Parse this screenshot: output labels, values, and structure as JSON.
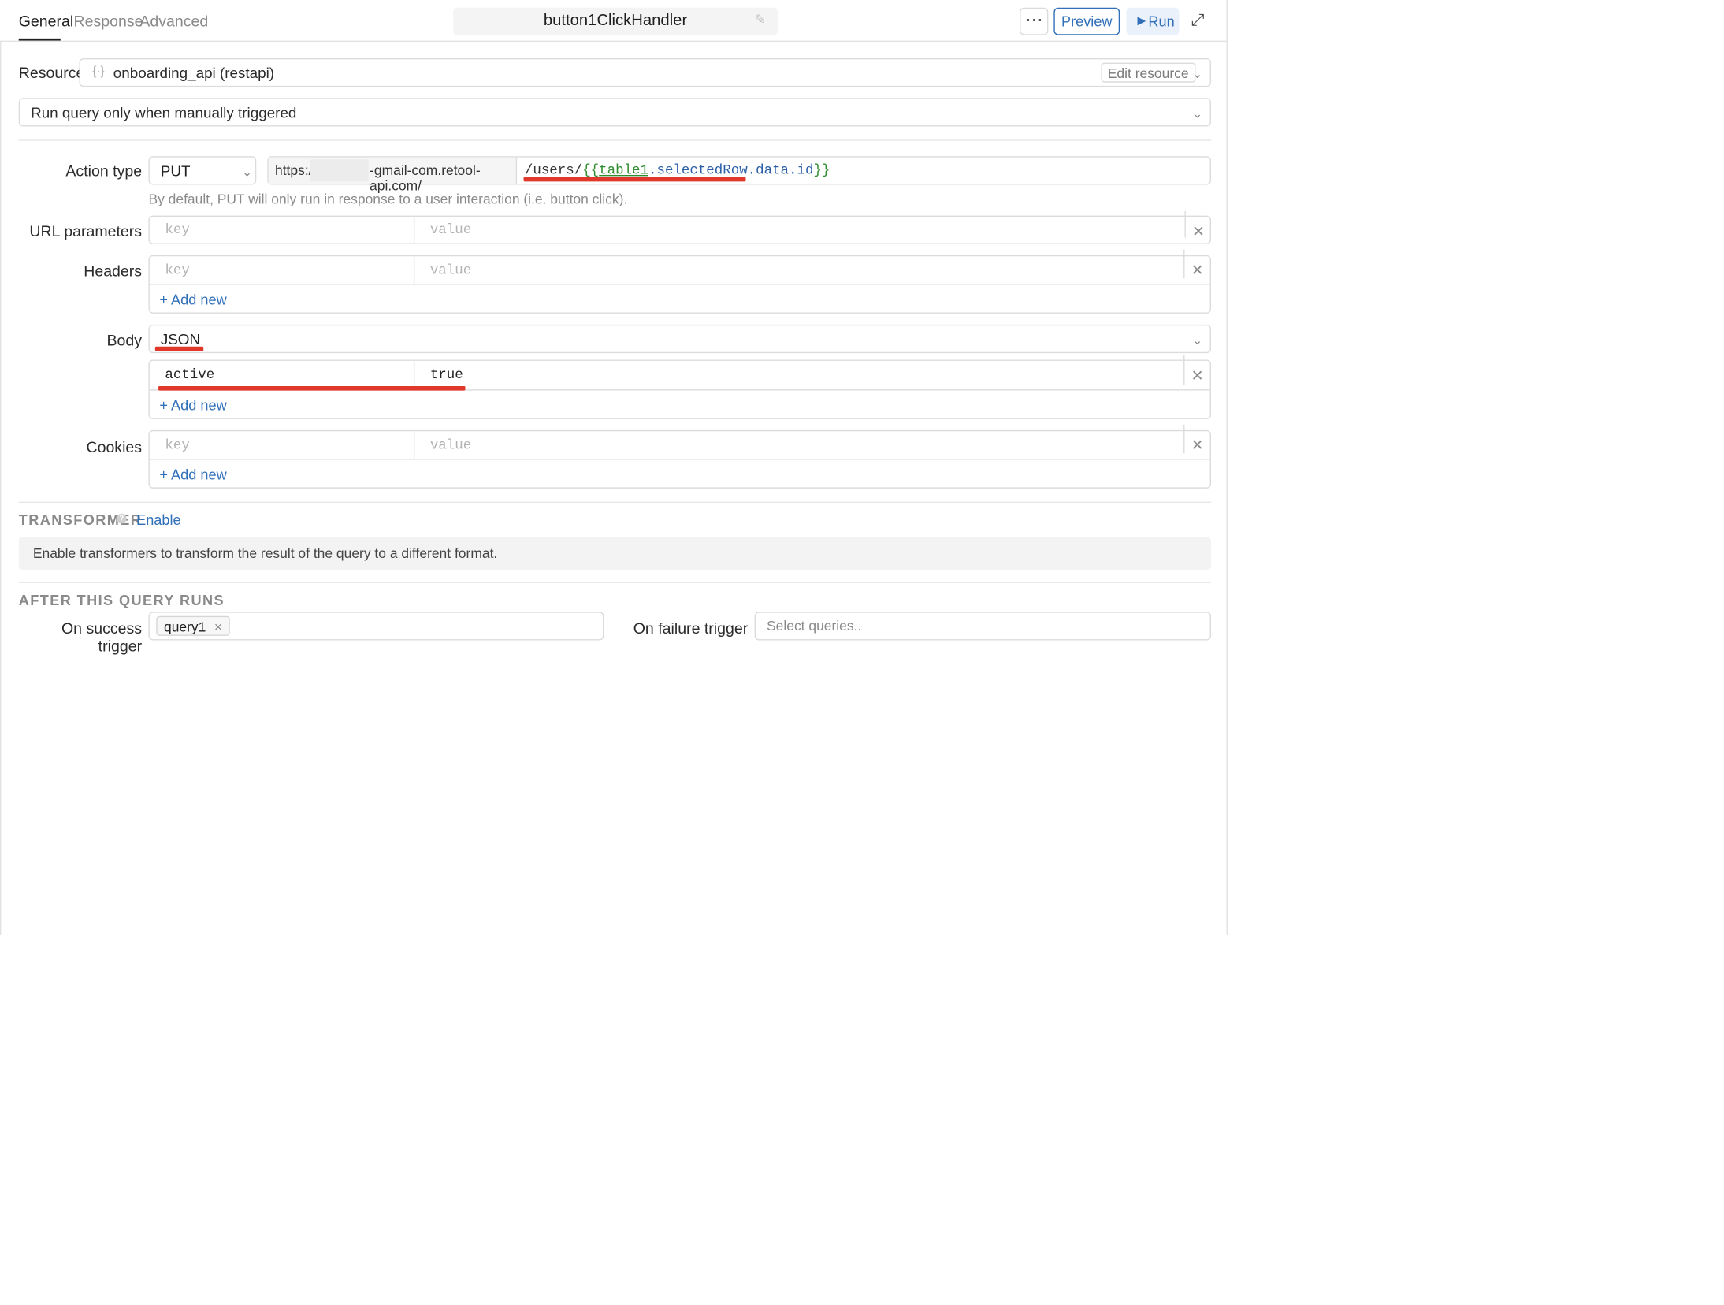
{
  "tabs": [
    "General",
    "Response",
    "Advanced"
  ],
  "query_name": "button1ClickHandler",
  "header": {
    "more_icon": "⋯",
    "preview_label": "Preview",
    "run_label": "Run",
    "expand_icon": "⤢"
  },
  "resource": {
    "label": "Resource",
    "value": "onboarding_api (restapi)",
    "edit_label": "Edit resource"
  },
  "trigger_mode": "Run query only when manually triggered",
  "action": {
    "label": "Action type",
    "method": "PUT",
    "base_url_prefix": "https:/",
    "base_url_suffix": "-gmail-com.retool-api.com/",
    "path_static": "/users/",
    "path_open": "{{",
    "path_ref": "table1",
    "path_rest": ".selectedRow.data.id",
    "path_close": "}}",
    "hint": "By default, PUT will only run in response to a user interaction (i.e. button click)."
  },
  "placeholders": {
    "key": "key",
    "value": "value"
  },
  "labels": {
    "url_params": "URL parameters",
    "headers": "Headers",
    "body": "Body",
    "cookies": "Cookies"
  },
  "add_new": "+ Add new",
  "body": {
    "type": "JSON",
    "key": "active",
    "value": "true"
  },
  "transformer": {
    "title": "TRANSFORMER",
    "enable_label": "Enable",
    "help_icon": "?",
    "description": "Enable transformers to transform the result of the query to a different format."
  },
  "after": {
    "title": "AFTER THIS QUERY RUNS",
    "success_label": "On success trigger",
    "success_tag": "query1",
    "failure_label": "On failure trigger",
    "failure_placeholder": "Select queries.."
  },
  "colors": {
    "accent": "#3170b9",
    "annotation": "#e0392b",
    "template_green": "#2f8b2f",
    "template_blue": "#2a5fa8"
  }
}
